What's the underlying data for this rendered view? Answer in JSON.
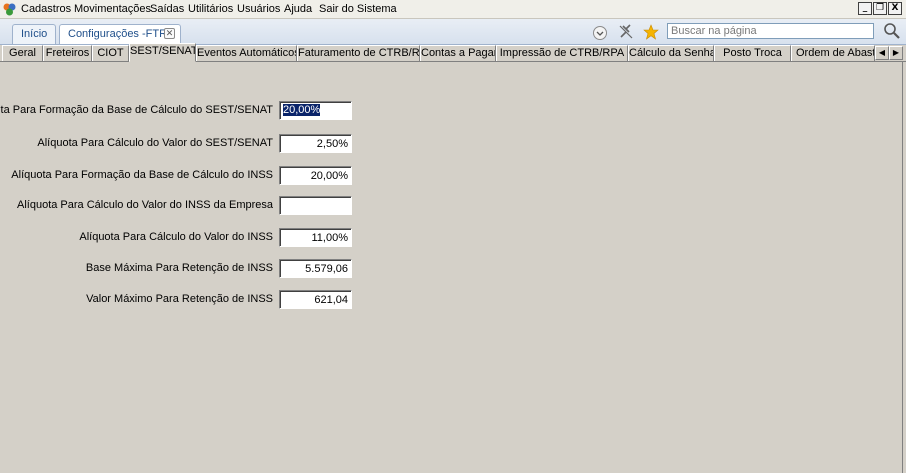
{
  "menu": {
    "items": [
      {
        "label": "Cadastros"
      },
      {
        "label": "Movimentações"
      },
      {
        "label": "Saídas"
      },
      {
        "label": "Utilitários"
      },
      {
        "label": "Usuários"
      },
      {
        "label": "Ajuda"
      },
      {
        "label": "Sair do Sistema"
      }
    ]
  },
  "window_controls": {
    "minimize": "_",
    "restore": "❐",
    "close": "X"
  },
  "doc_tabs": [
    {
      "label": "Início"
    },
    {
      "label": "Configurações -FTR"
    }
  ],
  "search": {
    "placeholder": "Buscar na página"
  },
  "config_tabs": [
    {
      "label": "Geral"
    },
    {
      "label": "Freteiros"
    },
    {
      "label": "CIOT"
    },
    {
      "label": "SEST/SENAT"
    },
    {
      "label": "Eventos Automáticos"
    },
    {
      "label": "Faturamento de CTRB/RPA"
    },
    {
      "label": "Contas a Pagar"
    },
    {
      "label": "Impressão de CTRB/RPA"
    },
    {
      "label": "Cálculo da Senha"
    },
    {
      "label": "Posto Troca"
    },
    {
      "label": "Ordem de Abastec"
    }
  ],
  "form": {
    "fields": [
      {
        "label": "Alíquota Para Formação da Base de Cálculo do SEST/SENAT",
        "value": "20,00%"
      },
      {
        "label": "Alíquota Para Cálculo do Valor do SEST/SENAT",
        "value": "2,50%"
      },
      {
        "label": "Alíquota Para Formação da Base de Cálculo do INSS",
        "value": "20,00%"
      },
      {
        "label": "Alíquota Para Cálculo do Valor do INSS da Empresa",
        "value": ""
      },
      {
        "label": "Alíquota Para Cálculo do Valor do INSS",
        "value": "11,00%"
      },
      {
        "label": "Base Máxima Para Retenção de INSS",
        "value": "5.579,06"
      },
      {
        "label": "Valor Máximo Para Retenção de INSS",
        "value": "621,04"
      }
    ]
  }
}
